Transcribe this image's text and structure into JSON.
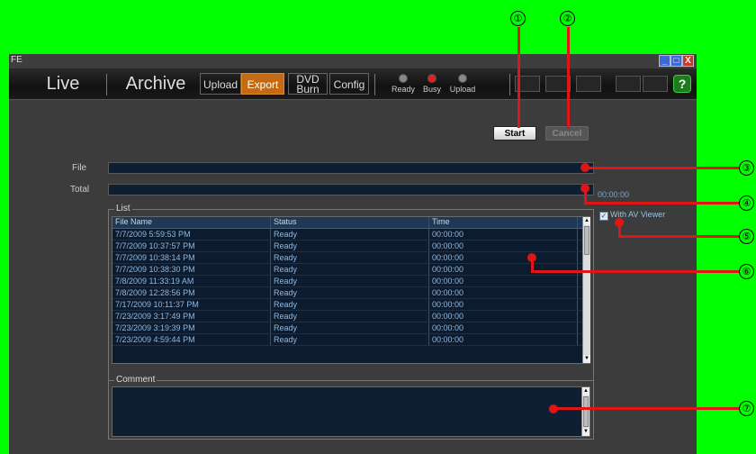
{
  "window": {
    "title": "FE",
    "controls": [
      "_",
      "□",
      "X"
    ]
  },
  "toolbar": {
    "tabs": [
      {
        "label": "Live"
      },
      {
        "label": "Archive"
      },
      {
        "label": "Upload"
      },
      {
        "label": "Export",
        "active": true
      },
      {
        "label_line1": "DVD",
        "label_line2": "Burn"
      },
      {
        "label": "Config"
      }
    ],
    "indicators": [
      {
        "label": "Ready",
        "color": "#888888"
      },
      {
        "label": "Busy",
        "color": "#e02020"
      },
      {
        "label": "Upload",
        "color": "#888888"
      }
    ],
    "help_label": "?"
  },
  "actions": {
    "start_label": "Start",
    "cancel_label": "Cancel"
  },
  "progress": {
    "file_label": "File",
    "total_label": "Total",
    "file_progress": 0,
    "total_progress": 0,
    "elapsed": "00:00:00"
  },
  "list": {
    "legend": "List",
    "with_av_viewer_label": "With AV Viewer",
    "with_av_viewer_checked": true,
    "columns": [
      "File Name",
      "Status",
      "Time"
    ],
    "rows": [
      [
        "7/7/2009 5:59:53 PM",
        "Ready",
        "00:00:00"
      ],
      [
        "7/7/2009 10:37:57 PM",
        "Ready",
        "00:00:00"
      ],
      [
        "7/7/2009 10:38:14 PM",
        "Ready",
        "00:00:00"
      ],
      [
        "7/7/2009 10:38:30 PM",
        "Ready",
        "00:00:00"
      ],
      [
        "7/8/2009 11:33:19 AM",
        "Ready",
        "00:00:00"
      ],
      [
        "7/8/2009 12:28:56 PM",
        "Ready",
        "00:00:00"
      ],
      [
        "7/17/2009 10:11:37 PM",
        "Ready",
        "00:00:00"
      ],
      [
        "7/23/2009 3:17:49 PM",
        "Ready",
        "00:00:00"
      ],
      [
        "7/23/2009 3:19:39 PM",
        "Ready",
        "00:00:00"
      ],
      [
        "7/23/2009 4:59:44 PM",
        "Ready",
        "00:00:00"
      ]
    ]
  },
  "comment": {
    "legend": "Comment",
    "value": ""
  },
  "callouts": [
    "①",
    "②",
    "③",
    "④",
    "⑤",
    "⑥",
    "⑦"
  ],
  "colors": {
    "background": "#00ff00",
    "accent_tab": "#c36a14",
    "callout_line": "#e01515"
  }
}
